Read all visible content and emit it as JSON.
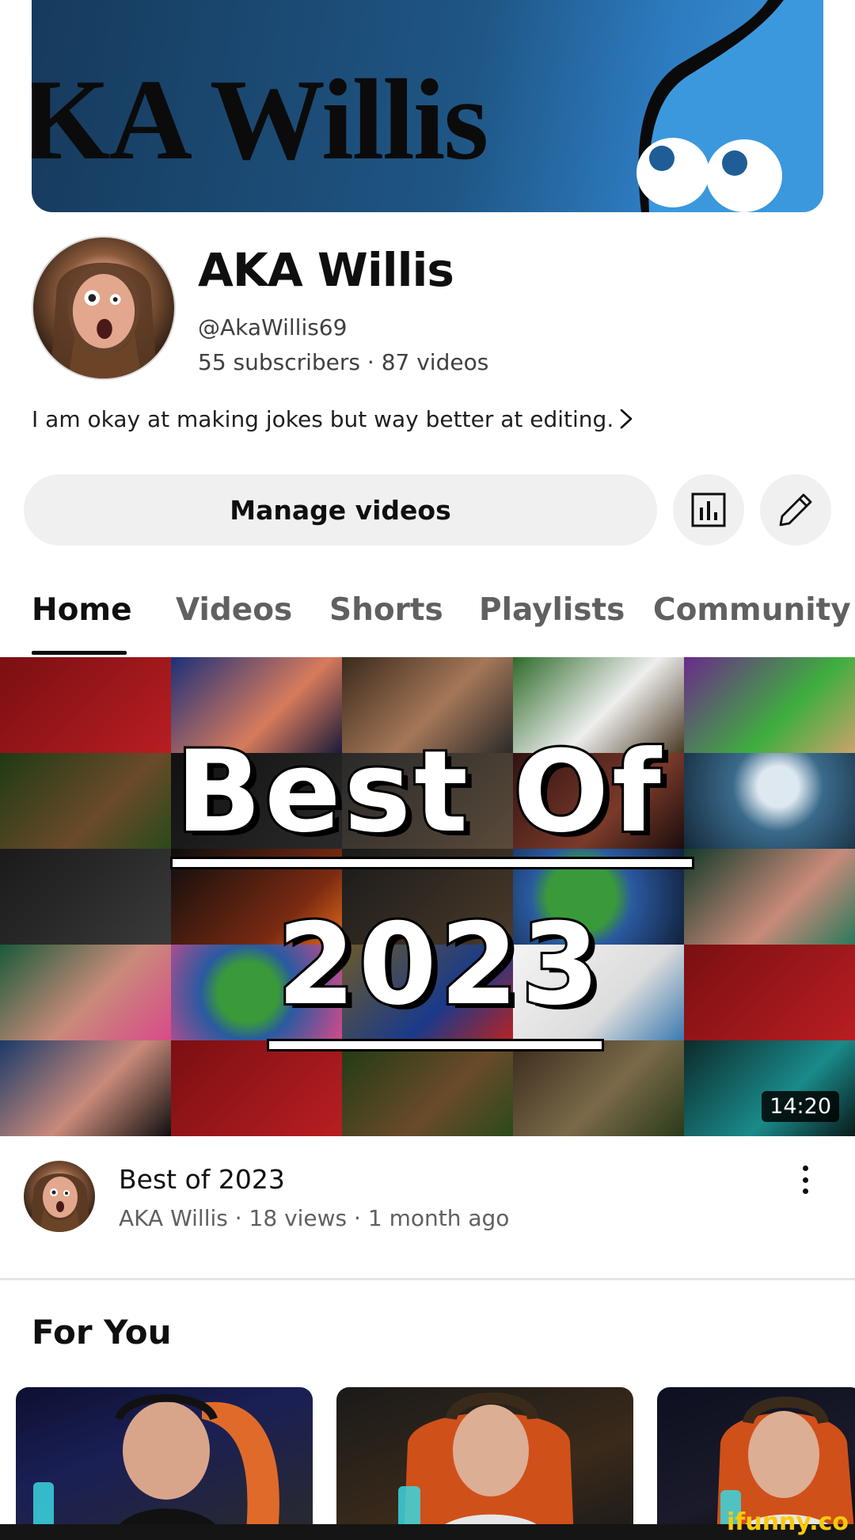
{
  "banner": {
    "text": "KA Willis"
  },
  "channel": {
    "name": "AKA Willis",
    "handle": "@AkaWillis69",
    "stats": "55 subscribers · 87 videos",
    "description": "I am okay at making jokes but way better at editing."
  },
  "actions": {
    "manage_label": "Manage videos",
    "stats_icon": "bar-chart-icon",
    "edit_icon": "pencil-icon"
  },
  "tabs": [
    {
      "label": "Home",
      "active": true
    },
    {
      "label": "Videos",
      "active": false
    },
    {
      "label": "Shorts",
      "active": false
    },
    {
      "label": "Playlists",
      "active": false
    },
    {
      "label": "Community",
      "active": false
    }
  ],
  "featured": {
    "thumb_line1": "Best Of",
    "thumb_line2": "2023",
    "duration": "14:20",
    "title": "Best of 2023",
    "meta": "AKA Willis · 18 views · 1 month ago"
  },
  "for_you": {
    "title": "For You"
  },
  "watermark": "ifunny.co",
  "colors": {
    "accent": "#0f0f0f",
    "chip_bg": "#f0f0f0",
    "banner_blue": "#2d7bc0"
  }
}
